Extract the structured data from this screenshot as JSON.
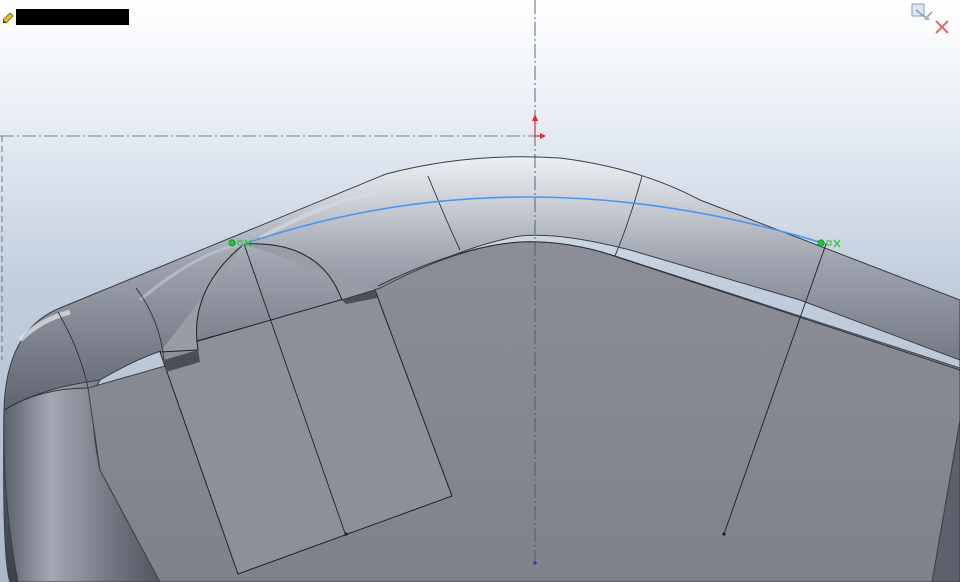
{
  "sketch_label": {
    "text": "",
    "icon": "sketch-pencil-icon"
  },
  "corner": {
    "confirm_icon": "confirm-sketch-icon",
    "cancel_icon": "cancel-sketch-icon"
  },
  "colors": {
    "spline": "#4a96f0",
    "relation_marker": "#22c43a",
    "origin_y_arrow": "#e0262e",
    "origin_point": "#2546c8",
    "centerline": "#4e5866",
    "cancel": "#e06a6a"
  }
}
